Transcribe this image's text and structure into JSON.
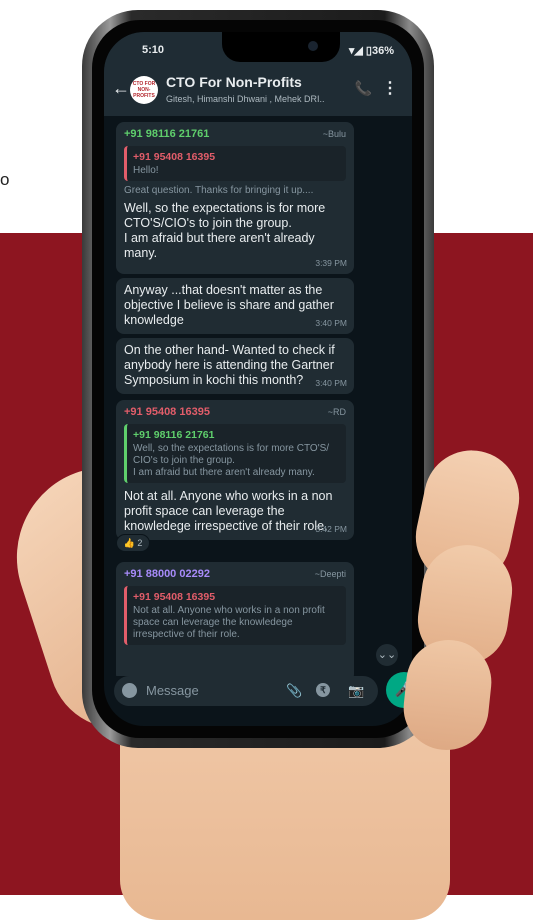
{
  "side_text": "o",
  "status": {
    "time": "5:10",
    "battery": "36%"
  },
  "header": {
    "title": "CTO For Non-Profits",
    "subtitle": "Gitesh, Himanshi Dhwani , Mehek DRI..",
    "avatar_text": "CTO FOR NON-PROFITS"
  },
  "messages": [
    {
      "sender": "+91 98116 21761",
      "alias": "~Bulu",
      "quote_sender": "+91 95408 16395",
      "quote_text": "Hello!",
      "quote_extra": "Great question. Thanks for bringing it up....",
      "text": "Well, so the expectations is for more CTO'S/CIO's to join the group.\nI am afraid but there aren't already many.",
      "time": "3:39 PM"
    },
    {
      "text": "Anyway ...that doesn't matter as the objective I believe is share and gather knowledge",
      "time": "3:40 PM"
    },
    {
      "text": "On the other hand- Wanted to check if anybody here is attending the Gartner Symposium in kochi this month?",
      "time": "3:40 PM"
    },
    {
      "sender": "+91 95408 16395",
      "alias": "~RD",
      "quote_sender": "+91 98116 21761",
      "quote_text": "Well, so the expectations is for more CTO'S/ CIO's to join the group.\nI am afraid but there aren't already many.",
      "text": "Not at all. Anyone who works in a non profit space can leverage the knowledege irrespective of their role.",
      "time": "3:42 PM",
      "reaction": "👍 2"
    },
    {
      "sender": "+91 88000 02292",
      "alias": "~Deepti",
      "quote_sender": "+91 95408 16395",
      "quote_text": "Not at all. Anyone who works in a non profit space can leverage the knowledege irrespective of their role."
    }
  ],
  "input": {
    "placeholder": "Message"
  },
  "icons": {
    "back": "←",
    "call": "📞",
    "menu": "⋮",
    "clip": "📎",
    "rupee": "₹",
    "camera": "📷",
    "mic": "🎤",
    "scroll": "⌄⌄"
  }
}
